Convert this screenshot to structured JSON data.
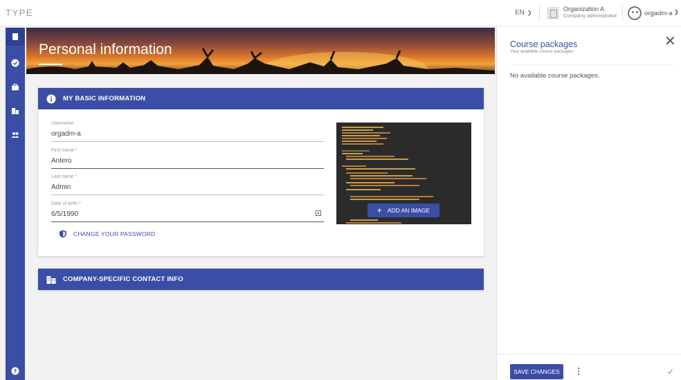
{
  "app": {
    "logo": "TYPE"
  },
  "topbar": {
    "language": "EN",
    "organization": "Organization A",
    "role": "Company administrator",
    "username": "orgadm-a"
  },
  "nav": {
    "items": [
      "book-icon",
      "check-circle-icon",
      "briefcase-icon",
      "building-icon",
      "people-icon"
    ],
    "help_icon": "help-icon"
  },
  "page": {
    "title": "Personal information"
  },
  "basic_info": {
    "header": "MY BASIC INFORMATION",
    "username_label": "Username",
    "username_value": "orgadm-a",
    "firstname_label": "First name *",
    "firstname_value": "Antero",
    "lastname_label": "Last name *",
    "lastname_value": "Admin",
    "dob_label": "Date of birth *",
    "dob_value": "6/5/1990",
    "change_password": "CHANGE YOUR PASSWORD",
    "add_image": "ADD AN IMAGE"
  },
  "contact_info": {
    "header": "COMPANY-SPECIFIC CONTACT INFO"
  },
  "course_panel": {
    "title": "Course packages",
    "subtitle": "Your available course packages",
    "empty": "No available course packages.",
    "save": "SAVE CHANGES"
  },
  "colors": {
    "primary": "#3a4ea6",
    "accent": "#3a4ea6"
  }
}
